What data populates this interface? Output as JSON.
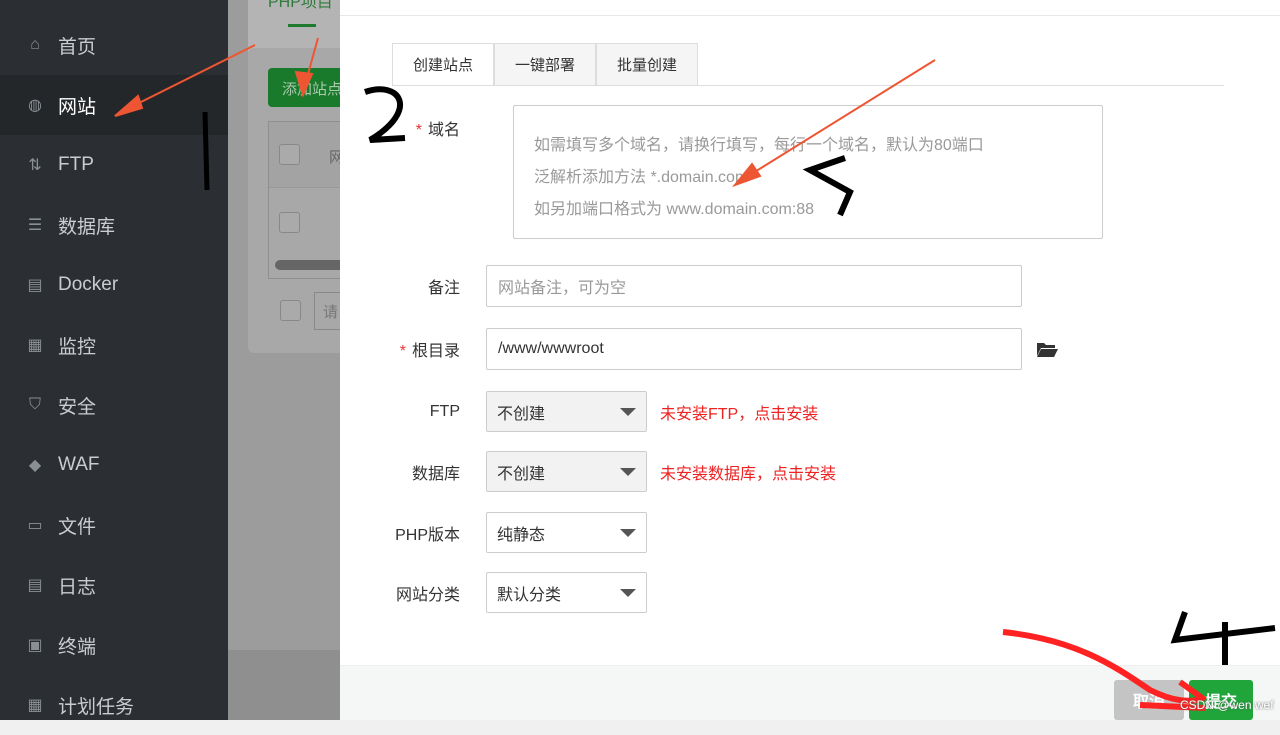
{
  "sidebar": {
    "items": [
      {
        "label": "首页",
        "icon": "home-icon"
      },
      {
        "label": "网站",
        "icon": "globe-icon",
        "active": true
      },
      {
        "label": "FTP",
        "icon": "ftp-icon"
      },
      {
        "label": "数据库",
        "icon": "database-icon"
      },
      {
        "label": "Docker",
        "icon": "docker-icon"
      },
      {
        "label": "监控",
        "icon": "monitor-icon"
      },
      {
        "label": "安全",
        "icon": "shield-icon"
      },
      {
        "label": "WAF",
        "icon": "waf-icon"
      },
      {
        "label": "文件",
        "icon": "folder-icon"
      },
      {
        "label": "日志",
        "icon": "log-icon"
      },
      {
        "label": "终端",
        "icon": "terminal-icon"
      },
      {
        "label": "计划任务",
        "icon": "calendar-icon"
      }
    ]
  },
  "background": {
    "tab": "PHP项目",
    "add_site": "添加站点",
    "col": "网",
    "search": "请"
  },
  "modal": {
    "tabs": [
      "创建站点",
      "一键部署",
      "批量创建"
    ],
    "domain": {
      "label": "域名",
      "placeholder_lines": [
        "如需填写多个域名，请换行填写，每行一个域名，默认为80端口",
        "泛解析添加方法 *.domain.com",
        "如另加端口格式为 www.domain.com:88"
      ]
    },
    "remark": {
      "label": "备注",
      "placeholder": "网站备注，可为空"
    },
    "root": {
      "label": "根目录",
      "value": "/www/wwwroot"
    },
    "ftp": {
      "label": "FTP",
      "value": "不创建",
      "warning": "未安装FTP，点击安装"
    },
    "database": {
      "label": "数据库",
      "value": "不创建",
      "warning": "未安装数据库，点击安装"
    },
    "php": {
      "label": "PHP版本",
      "value": "纯静态"
    },
    "category": {
      "label": "网站分类",
      "value": "默认分类"
    },
    "cancel": "取消",
    "submit": "提交"
  },
  "annotations": [
    "1",
    "2",
    "5",
    "4"
  ],
  "watermark": "CSDN @wen wef",
  "colors": {
    "green": "#20a53a",
    "warn": "#ee2222",
    "sidebar": "#2b2f33"
  }
}
